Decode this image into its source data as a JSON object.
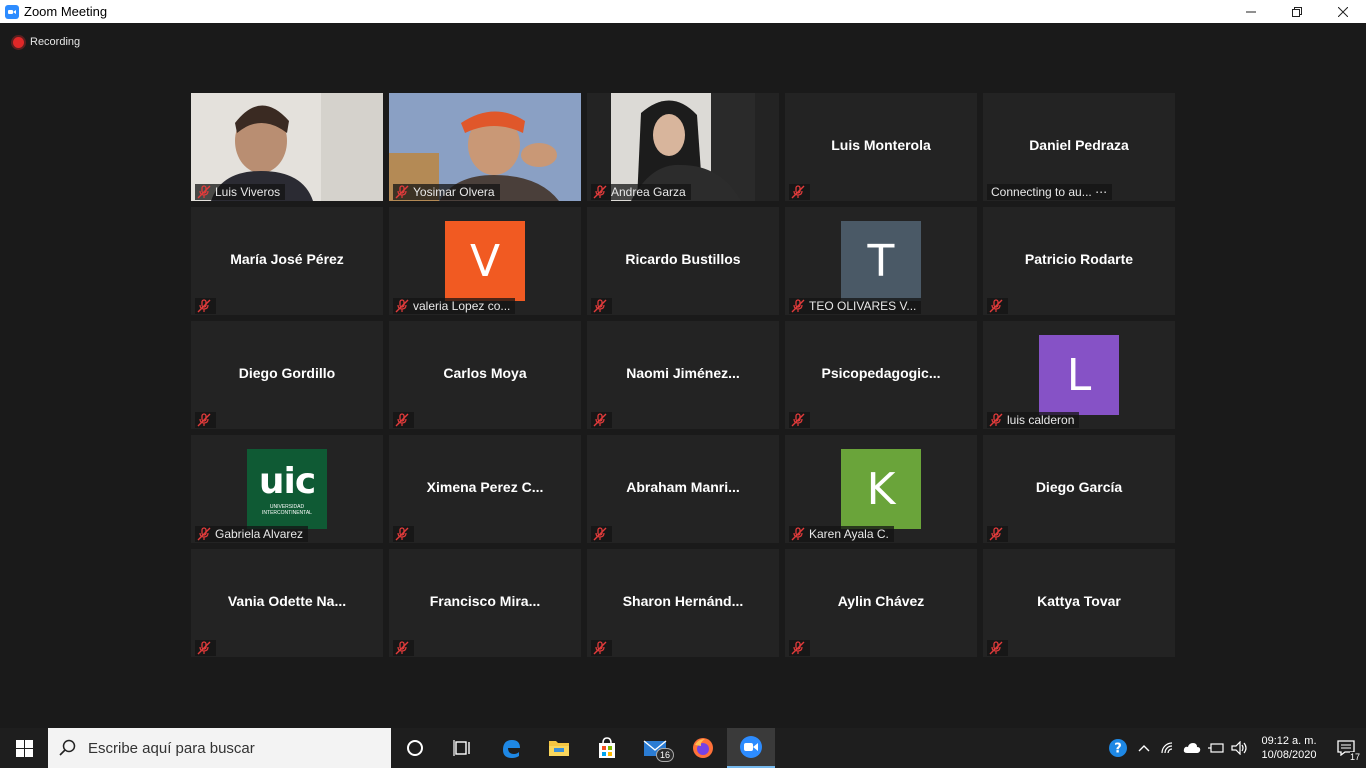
{
  "window": {
    "title": "Zoom Meeting"
  },
  "recording": {
    "label": "Recording"
  },
  "participants": [
    {
      "name": "Luis Viveros",
      "center": "",
      "type": "video"
    },
    {
      "name": "Yosimar Olvera",
      "center": "",
      "type": "video"
    },
    {
      "name": "Andrea Garza",
      "center": "",
      "type": "video"
    },
    {
      "name": "",
      "center": "Luis Monterola",
      "type": "name"
    },
    {
      "name": "Connecting to au... ⋯",
      "center": "Daniel Pedraza",
      "type": "name"
    },
    {
      "name": "",
      "center": "María José Pérez",
      "type": "name"
    },
    {
      "name": "valeria Lopez co...",
      "center": "",
      "type": "avatar",
      "initial": "V",
      "color": "#f15a22"
    },
    {
      "name": "",
      "center": "Ricardo Bustillos",
      "type": "name"
    },
    {
      "name": "TEO OLIVARES V...",
      "center": "",
      "type": "avatar",
      "initial": "T",
      "color": "#4a5966"
    },
    {
      "name": "",
      "center": "Patricio Rodarte",
      "type": "name"
    },
    {
      "name": "",
      "center": "Diego Gordillo",
      "type": "name"
    },
    {
      "name": "",
      "center": "Carlos Moya",
      "type": "name"
    },
    {
      "name": "",
      "center": "Naomi  Jiménez...",
      "type": "name"
    },
    {
      "name": "",
      "center": "Psicopedagogic...",
      "type": "name"
    },
    {
      "name": "luis calderon",
      "center": "",
      "type": "avatar",
      "initial": "L",
      "color": "#8652c6"
    },
    {
      "name": "Gabriela Alvarez",
      "center": "",
      "type": "logo",
      "logo_text": "UIC",
      "logo_sub": "UNIVERSIDAD INTERCONTINENTAL"
    },
    {
      "name": "",
      "center": "Ximena  Perez  C...",
      "type": "name"
    },
    {
      "name": "",
      "center": "Abraham  Manri...",
      "type": "name"
    },
    {
      "name": "Karen Ayala C.",
      "center": "",
      "type": "avatar",
      "initial": "K",
      "color": "#6aa43a"
    },
    {
      "name": "",
      "center": "Diego García",
      "type": "name"
    },
    {
      "name": "",
      "center": "Vania  Odette  Na...",
      "type": "name"
    },
    {
      "name": "",
      "center": "Francisco  Mira...",
      "type": "name"
    },
    {
      "name": "",
      "center": "Sharon  Hernánd...",
      "type": "name"
    },
    {
      "name": "",
      "center": "Aylin Chávez",
      "type": "name"
    },
    {
      "name": "",
      "center": "Kattya Tovar",
      "type": "name"
    }
  ],
  "taskbar": {
    "search_placeholder": "Escribe aquí para buscar",
    "mail_badge": "16",
    "time": "09:12 a. m.",
    "date": "10/08/2020",
    "notification_count": "17"
  }
}
